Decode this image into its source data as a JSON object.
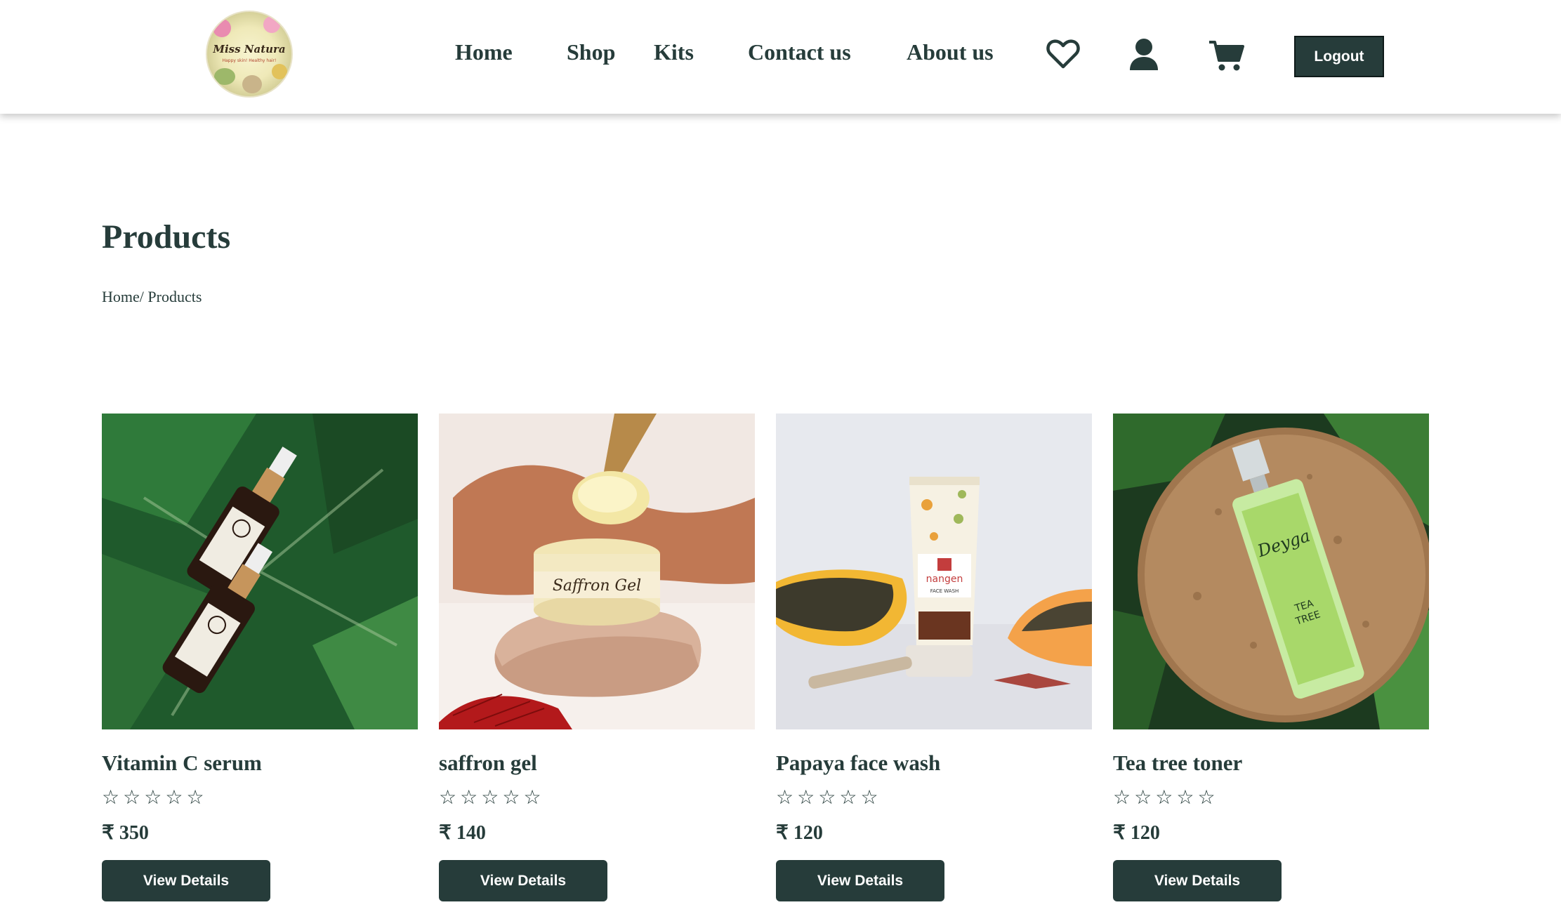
{
  "header": {
    "logo": {
      "brand": "Miss Natura",
      "tagline": "Happy skin! Healthy hair!"
    },
    "nav": [
      {
        "label": "Home"
      },
      {
        "label": "Shop"
      },
      {
        "label": "Kits"
      },
      {
        "label": "Contact us"
      },
      {
        "label": "About us"
      }
    ],
    "icons": [
      "heart-icon",
      "user-icon",
      "cart-icon"
    ],
    "logout_label": "Logout"
  },
  "page": {
    "title": "Products",
    "breadcrumb": {
      "home": "Home",
      "separator": "/ ",
      "current": "Products"
    }
  },
  "products": [
    {
      "name": "Vitamin C serum",
      "price": "₹ 350",
      "rating": 0,
      "button": "View Details"
    },
    {
      "name": "saffron gel",
      "price": "₹ 140",
      "rating": 0,
      "button": "View Details"
    },
    {
      "name": "Papaya face wash",
      "price": "₹ 120",
      "rating": 0,
      "button": "View Details"
    },
    {
      "name": "Tea tree toner",
      "price": "₹ 120",
      "rating": 0,
      "button": "View Details"
    }
  ],
  "colors": {
    "primary": "#263c3a",
    "background": "#ffffff"
  }
}
